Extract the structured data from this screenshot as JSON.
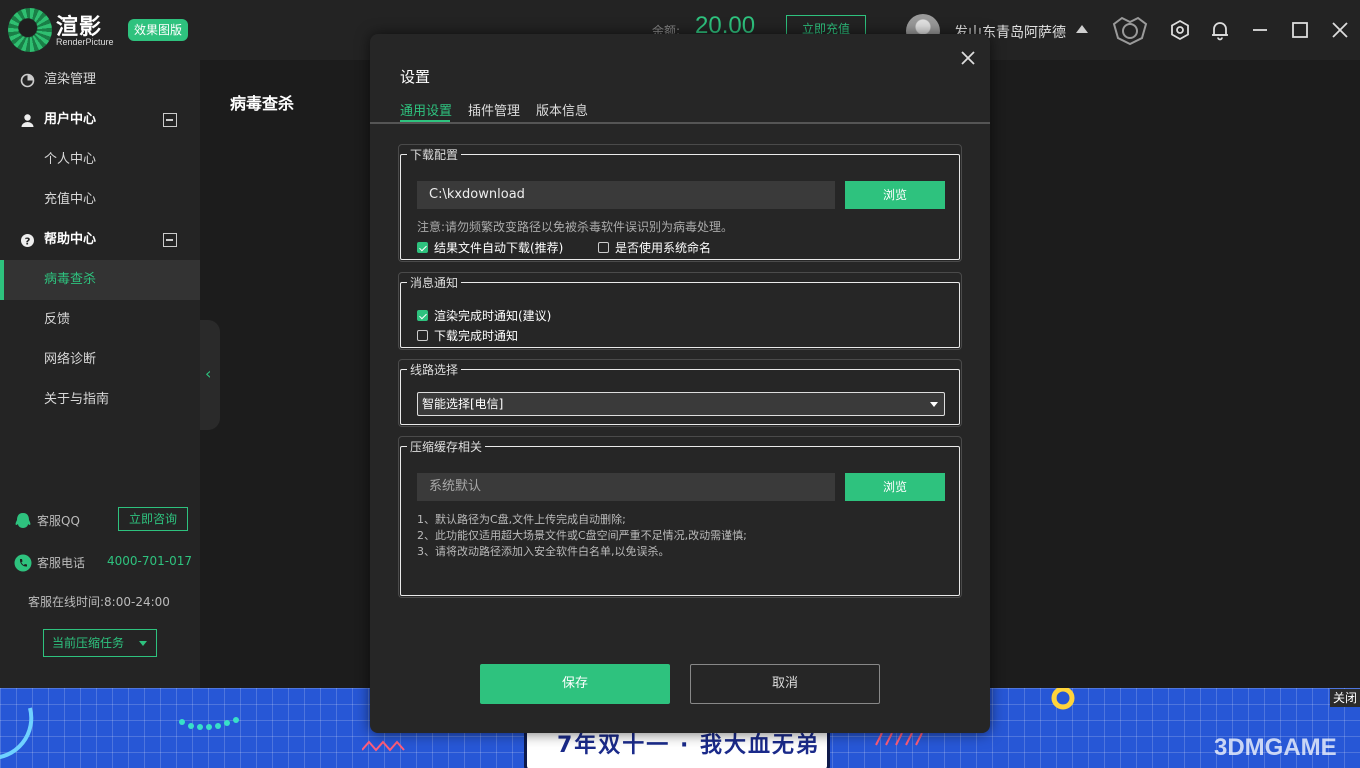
{
  "header": {
    "brand_name": "渲影",
    "brand_sub": "RenderPicture",
    "brand_badge": "效果图版",
    "balance_label": "余额:",
    "balance_value": "20.00",
    "recharge_label": "立即充值",
    "username": "发山东青岛阿萨德"
  },
  "sidebar": {
    "items": [
      {
        "label": "渲染管理"
      },
      {
        "label": "用户中心"
      },
      {
        "label": "个人中心"
      },
      {
        "label": "充值中心"
      },
      {
        "label": "帮助中心"
      },
      {
        "label": "病毒查杀"
      },
      {
        "label": "反馈"
      },
      {
        "label": "网络诊断"
      },
      {
        "label": "关于与指南"
      }
    ],
    "qq_label": "客服QQ",
    "qq_button": "立即咨询",
    "tel_label": "客服电话",
    "tel_value": "4000-701-017",
    "hours": "客服在线时间:8:00-24:00",
    "task_button": "当前压缩任务"
  },
  "main": {
    "page_title": "病毒查杀"
  },
  "dialog": {
    "title": "设置",
    "tabs": [
      {
        "label": "通用设置"
      },
      {
        "label": "插件管理"
      },
      {
        "label": "版本信息"
      }
    ],
    "download": {
      "legend": "下载配置",
      "path": "C:\\kxdownload",
      "browse": "浏览",
      "note": "注意:请勿频繁改变路径以免被杀毒软件误识别为病毒处理。",
      "auto_download": "结果文件自动下载(推荐)",
      "system_naming": "是否使用系统命名"
    },
    "notify": {
      "legend": "消息通知",
      "render_done": "渲染完成时通知(建议)",
      "download_done": "下载完成时通知"
    },
    "route": {
      "legend": "线路选择",
      "selected": "智能选择[电信]"
    },
    "cache": {
      "legend": "压缩缓存相关",
      "placeholder": "系统默认",
      "browse": "浏览",
      "tips": [
        "1、默认路径为C盘,文件上传完成自动删除;",
        "2、此功能仅适用超大场景文件或C盘空间严重不足情况,改动需谨慎;",
        "3、请将改动路径添加入安全软件白名单,以免误杀。"
      ]
    },
    "save": "保存",
    "cancel": "取消"
  },
  "banner": {
    "text": "7年双十一 · 我大血无弟",
    "close": "关闭",
    "watermark": "3DMGAME"
  },
  "colors": {
    "accent": "#2ec27e",
    "background": "#1f1f1f",
    "dialog": "#262626",
    "banner": "#2757d6"
  }
}
